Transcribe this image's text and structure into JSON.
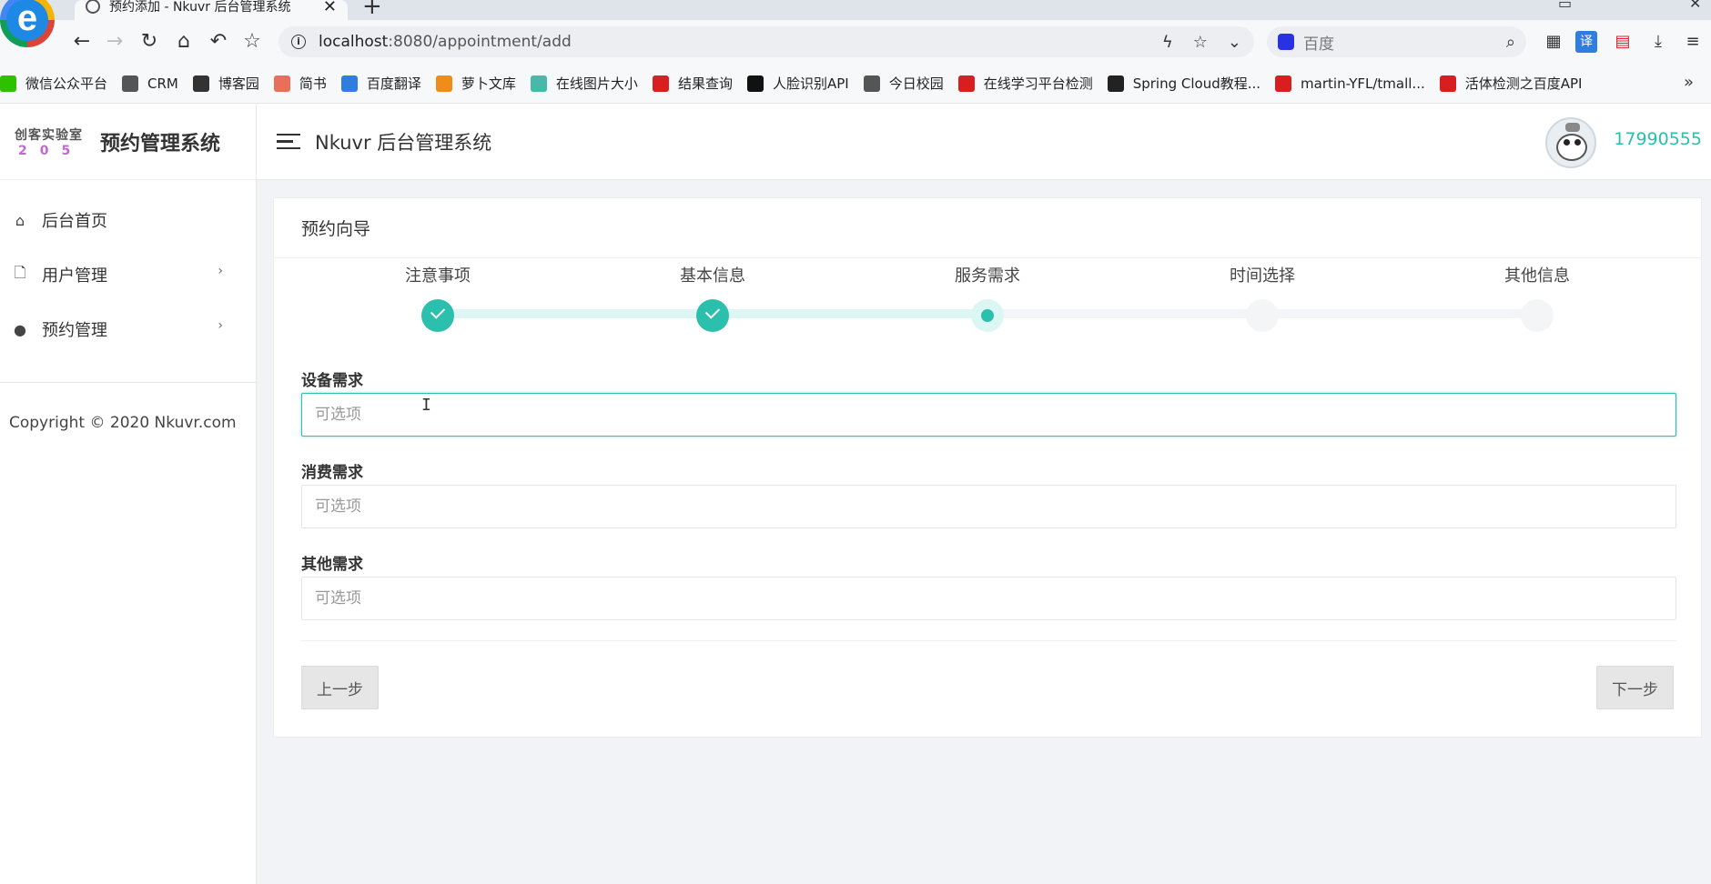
{
  "browser": {
    "tab_title": "预约添加 - Nkuvr 后台管理系统",
    "tab_close": "✕",
    "new_tab": "+",
    "url_host": "localhost",
    "url_path": ":8080/appointment/add",
    "search_placeholder": "百度",
    "bookmarks": [
      {
        "label": "微信公众平台",
        "color": "#2dc100"
      },
      {
        "label": "CRM",
        "color": "#555555"
      },
      {
        "label": "博客园",
        "color": "#333333"
      },
      {
        "label": "简书",
        "color": "#ea6f5a"
      },
      {
        "label": "百度翻译",
        "color": "#2f7de1"
      },
      {
        "label": "萝卜文库",
        "color": "#f08c1a"
      },
      {
        "label": "在线图片大小",
        "color": "#48b9a8"
      },
      {
        "label": "结果查询",
        "color": "#d81e1e"
      },
      {
        "label": "人脸识别API",
        "color": "#111111"
      },
      {
        "label": "今日校园",
        "color": "#555555"
      },
      {
        "label": "在线学习平台检测",
        "color": "#d81e1e"
      },
      {
        "label": "Spring Cloud教程...",
        "color": "#222222"
      },
      {
        "label": "martin-YFL/tmall...",
        "color": "#d81e1e"
      },
      {
        "label": "活体检测之百度API",
        "color": "#d81e1e"
      }
    ]
  },
  "sidebar": {
    "logo_line1": "创客实验室",
    "logo_line2": "205",
    "title": "预约管理系统",
    "items": [
      {
        "label": "后台首页",
        "icon": "home-icon"
      },
      {
        "label": "用户管理",
        "icon": "file-icon"
      },
      {
        "label": "预约管理",
        "icon": "palette-icon"
      }
    ],
    "copyright": "Copyright © 2020 Nkuvr.com"
  },
  "topnav": {
    "title": "Nkuvr 后台管理系统",
    "username": "17990555"
  },
  "wizard": {
    "title": "预约向导",
    "steps": [
      {
        "label": "注意事项",
        "status": "done"
      },
      {
        "label": "基本信息",
        "status": "done"
      },
      {
        "label": "服务需求",
        "status": "active"
      },
      {
        "label": "时间选择",
        "status": "todo"
      },
      {
        "label": "其他信息",
        "status": "todo"
      }
    ],
    "fields": [
      {
        "label": "设备需求",
        "placeholder": "可选项",
        "value": ""
      },
      {
        "label": "消费需求",
        "placeholder": "可选项",
        "value": ""
      },
      {
        "label": "其他需求",
        "placeholder": "可选项",
        "value": ""
      }
    ],
    "prev_label": "上一步",
    "next_label": "下一步"
  },
  "colors": {
    "accent": "#2bbfae",
    "accent_light": "#ddf6f3"
  }
}
